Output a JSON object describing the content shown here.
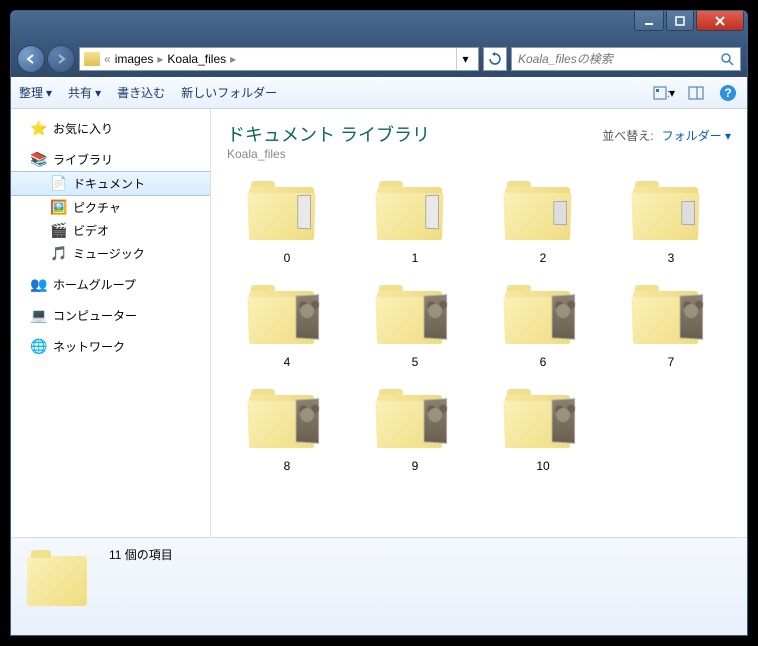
{
  "breadcrumb": {
    "sep": "«",
    "p1": "images",
    "p2": "Koala_files",
    "arrow": "▸"
  },
  "search": {
    "placeholder": "Koala_filesの検索"
  },
  "toolbar": {
    "organize": "整理",
    "share": "共有",
    "burn": "書き込む",
    "newfolder": "新しいフォルダー"
  },
  "sidebar": {
    "favorites": "お気に入り",
    "libraries": "ライブラリ",
    "documents": "ドキュメント",
    "pictures": "ピクチャ",
    "videos": "ビデオ",
    "music": "ミュージック",
    "homegroup": "ホームグループ",
    "computer": "コンピューター",
    "network": "ネットワーク"
  },
  "content": {
    "title": "ドキュメント ライブラリ",
    "subtitle": "Koala_files",
    "sortLabel": "並べ替え:",
    "sortValue": "フォルダー"
  },
  "folders": [
    {
      "name": "0",
      "thumb": "blank"
    },
    {
      "name": "1",
      "thumb": "blank"
    },
    {
      "name": "2",
      "thumb": "small"
    },
    {
      "name": "3",
      "thumb": "small"
    },
    {
      "name": "4",
      "thumb": "koala"
    },
    {
      "name": "5",
      "thumb": "koala"
    },
    {
      "name": "6",
      "thumb": "koala"
    },
    {
      "name": "7",
      "thumb": "koala"
    },
    {
      "name": "8",
      "thumb": "koala"
    },
    {
      "name": "9",
      "thumb": "koala"
    },
    {
      "name": "10",
      "thumb": "koala"
    }
  ],
  "status": {
    "count": "11 個の項目"
  }
}
